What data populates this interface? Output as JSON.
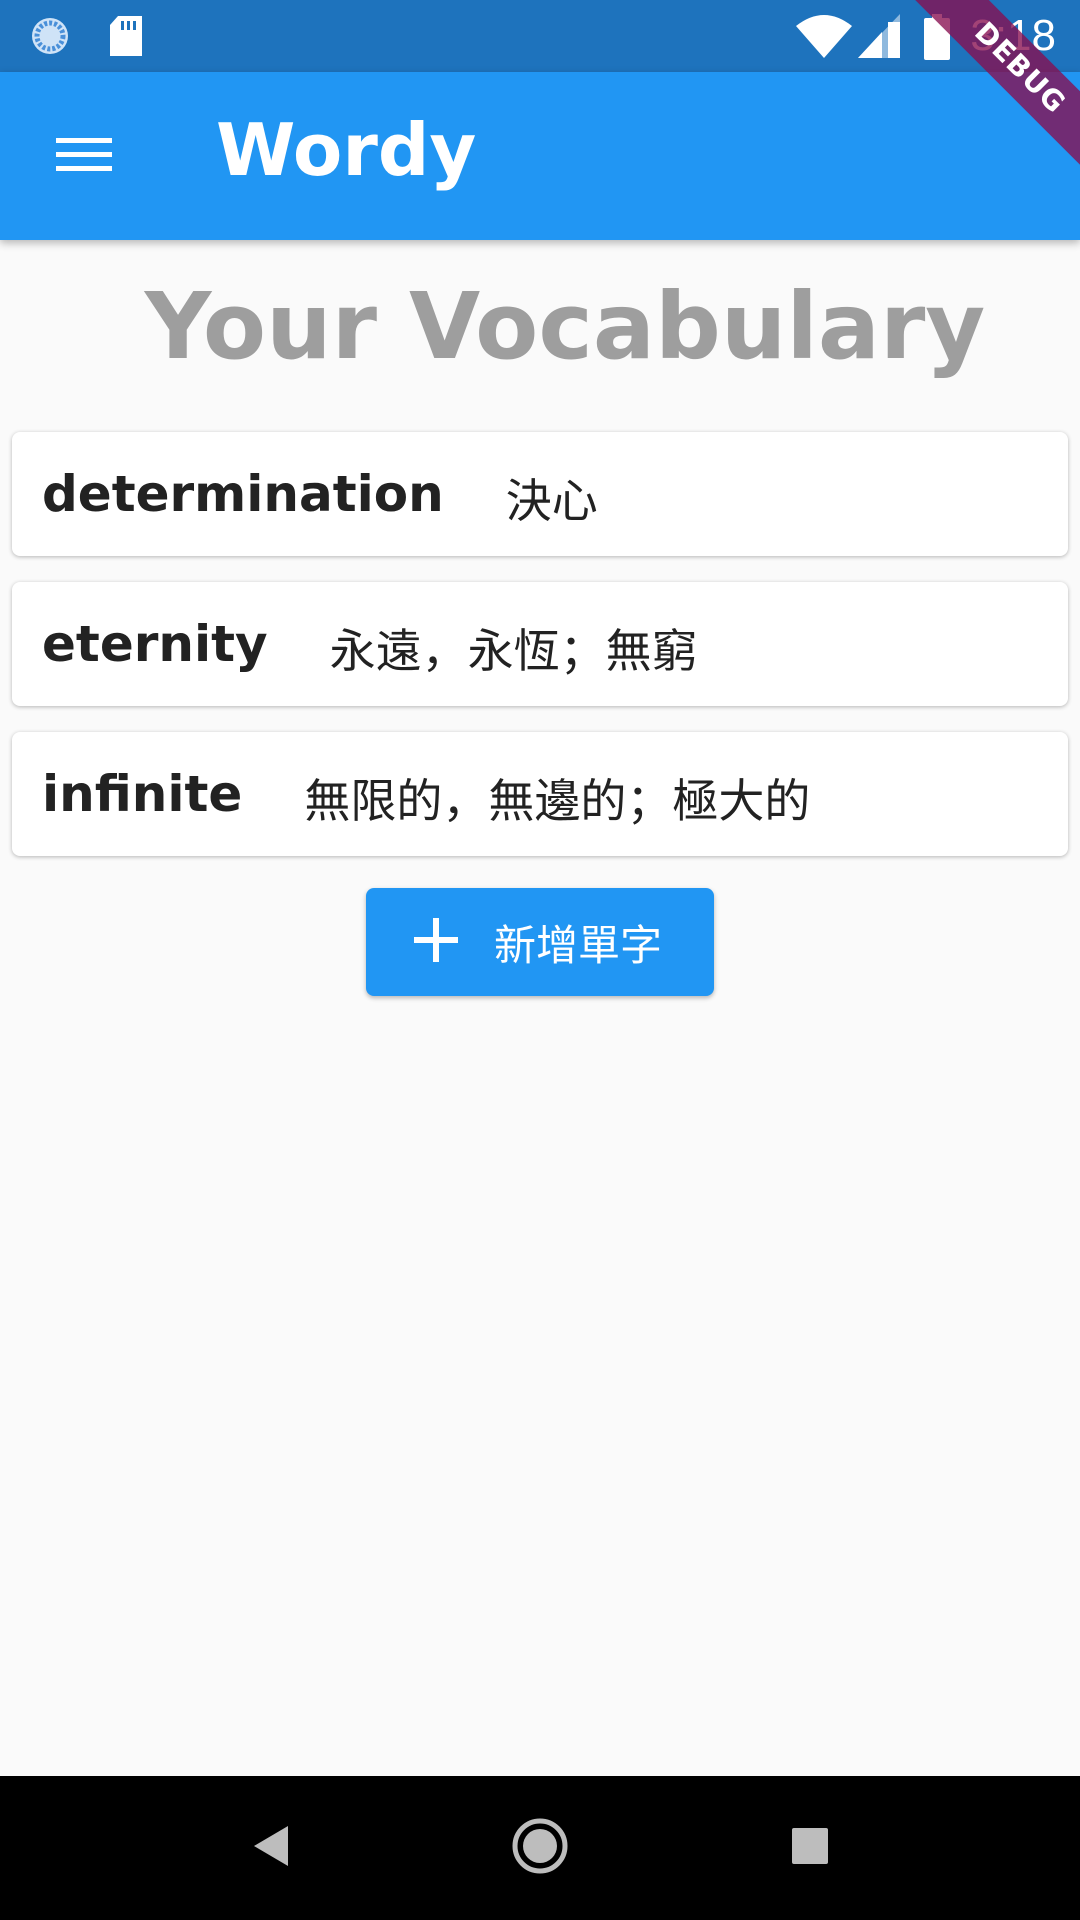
{
  "status_bar": {
    "time": "3:18",
    "icons": [
      "sync-icon",
      "sd-card-icon",
      "wifi-icon",
      "cell-signal-icon",
      "battery-icon"
    ]
  },
  "debug_banner": "DEBUG",
  "app_bar": {
    "title": "Wordy",
    "menu_icon": "hamburger-menu-icon",
    "color": "#2196f3"
  },
  "heading": "Your Vocabulary",
  "words": [
    {
      "term": "determination",
      "meaning": "決心"
    },
    {
      "term": "eternity",
      "meaning": "永遠，永恆；無窮"
    },
    {
      "term": "infinite",
      "meaning": "無限的，無邊的；極大的"
    }
  ],
  "add_button": {
    "icon": "plus-icon",
    "label": "新增單字"
  },
  "nav_bar": {
    "icons": [
      "back-icon",
      "home-icon",
      "recents-icon"
    ]
  }
}
